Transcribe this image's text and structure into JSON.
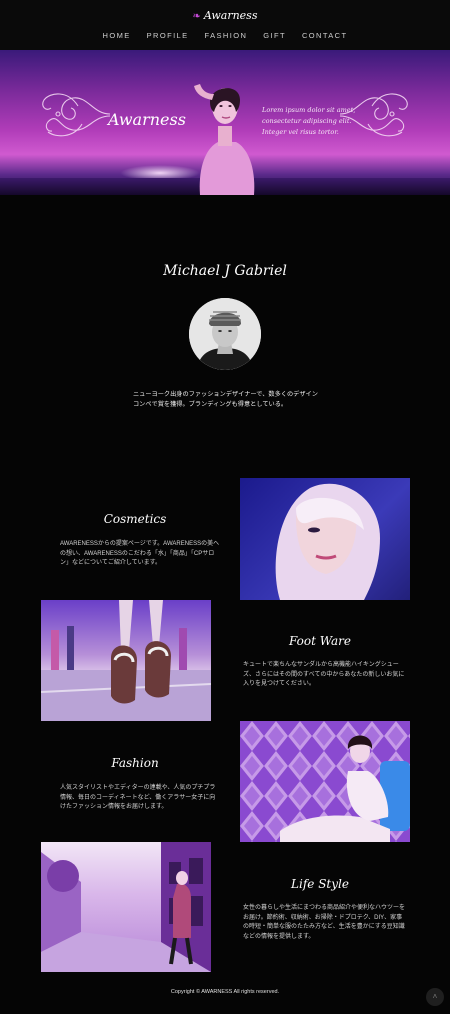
{
  "header": {
    "logo_text": "Awarness",
    "logo_icon": "butterfly-icon",
    "nav": [
      "HOME",
      "PROFILE",
      "FASHION",
      "GIFT",
      "CONTACT"
    ]
  },
  "hero": {
    "title": "Awarness",
    "text": "Lorem ipsum dolor sit amet, consectetur adipiscing elit. Integer vel risus tortor."
  },
  "profile": {
    "name": "Michael J Gabriel",
    "bio": "ニューヨーク出身のファッションデザイナーで、数多くのデザインコンペで賞を獲得。ブランディングも得意としている。"
  },
  "sections": [
    {
      "title": "Cosmetics",
      "text": "AWARENESSからの提案ページです。AWARENESSの美への想い、AWARENESSのこだわる「水」「商品」「CPサロン」などについてご紹介しています。"
    },
    {
      "title": "Foot Ware",
      "text": "キュートで楽ちんなサンダルから高機能ハイキングシューズ、さらにはその間のすべての中からあなたの新しいお気に入りを見つけてください。"
    },
    {
      "title": "Fashion",
      "text": "人気スタイリストやエディターの連載や、人気のプチプラ情報、毎日のコーディネートなど、働くアラサー女子に向けたファッション情報をお届けします。"
    },
    {
      "title": "Life Style",
      "text": "女性の暮らしや生活にまつわる商品紹介や便利なハウツーをお届け。節約術、収納術、お掃除・ドプロテク、DIY、家事の時短・簡単な服のたたみ方など、生活を豊かにする豆知識などの情報を提供します。"
    }
  ],
  "footer": {
    "copyright": "Copyright © AWARNESS All rights reserved.",
    "to_top_icon": "chevron-up-icon"
  },
  "colors": {
    "accent": "#c64bd8",
    "background": "#050505"
  }
}
